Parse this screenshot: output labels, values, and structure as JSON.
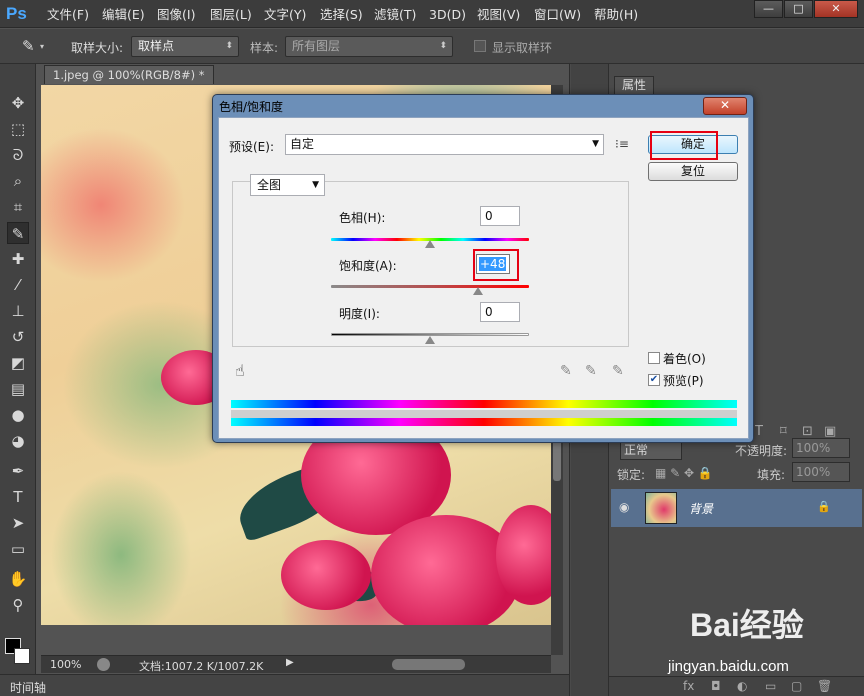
{
  "app": {
    "logo": "Ps"
  },
  "menu": [
    "文件(F)",
    "编辑(E)",
    "图像(I)",
    "图层(L)",
    "文字(Y)",
    "选择(S)",
    "滤镜(T)",
    "3D(D)",
    "视图(V)",
    "窗口(W)",
    "帮助(H)"
  ],
  "window_controls": {
    "minimize": "—",
    "maximize": "□",
    "close": "✕"
  },
  "options_bar": {
    "sample_size_label": "取样大小:",
    "sample_size_value": "取样点",
    "sample_label": "样本:",
    "sample_value": "所有图层",
    "show_ring_label": "显示取样环"
  },
  "document": {
    "tab_title": "1.jpeg @ 100%(RGB/8#) *",
    "tab_close": "×",
    "zoom": "100%",
    "doc_size": "文档:1007.2 K/1007.2K"
  },
  "timeline_label": "时间轴",
  "right_panel": {
    "properties_tab": "属性",
    "normal_label": "正常",
    "opacity_label": "不透明度:",
    "opacity_value": "100%",
    "lock_label": "锁定:",
    "fill_label": "填充:",
    "fill_value": "100%",
    "layer_name": "背景"
  },
  "dialog": {
    "title": "色相/饱和度",
    "close": "✕",
    "preset_label": "预设(E):",
    "preset_value": "自定",
    "channel_value": "全图",
    "ok_label": "确定",
    "reset_label": "复位",
    "hue_label": "色相(H):",
    "hue_value": "0",
    "saturation_label": "饱和度(A):",
    "saturation_value": "+48",
    "lightness_label": "明度(I):",
    "lightness_value": "0",
    "colorize_label": "着色(O)",
    "colorize_checked": false,
    "preview_label": "预览(P)",
    "preview_checked": true
  },
  "watermark": {
    "brand": "Bai经验",
    "url": "jingyan.baidu.com"
  }
}
